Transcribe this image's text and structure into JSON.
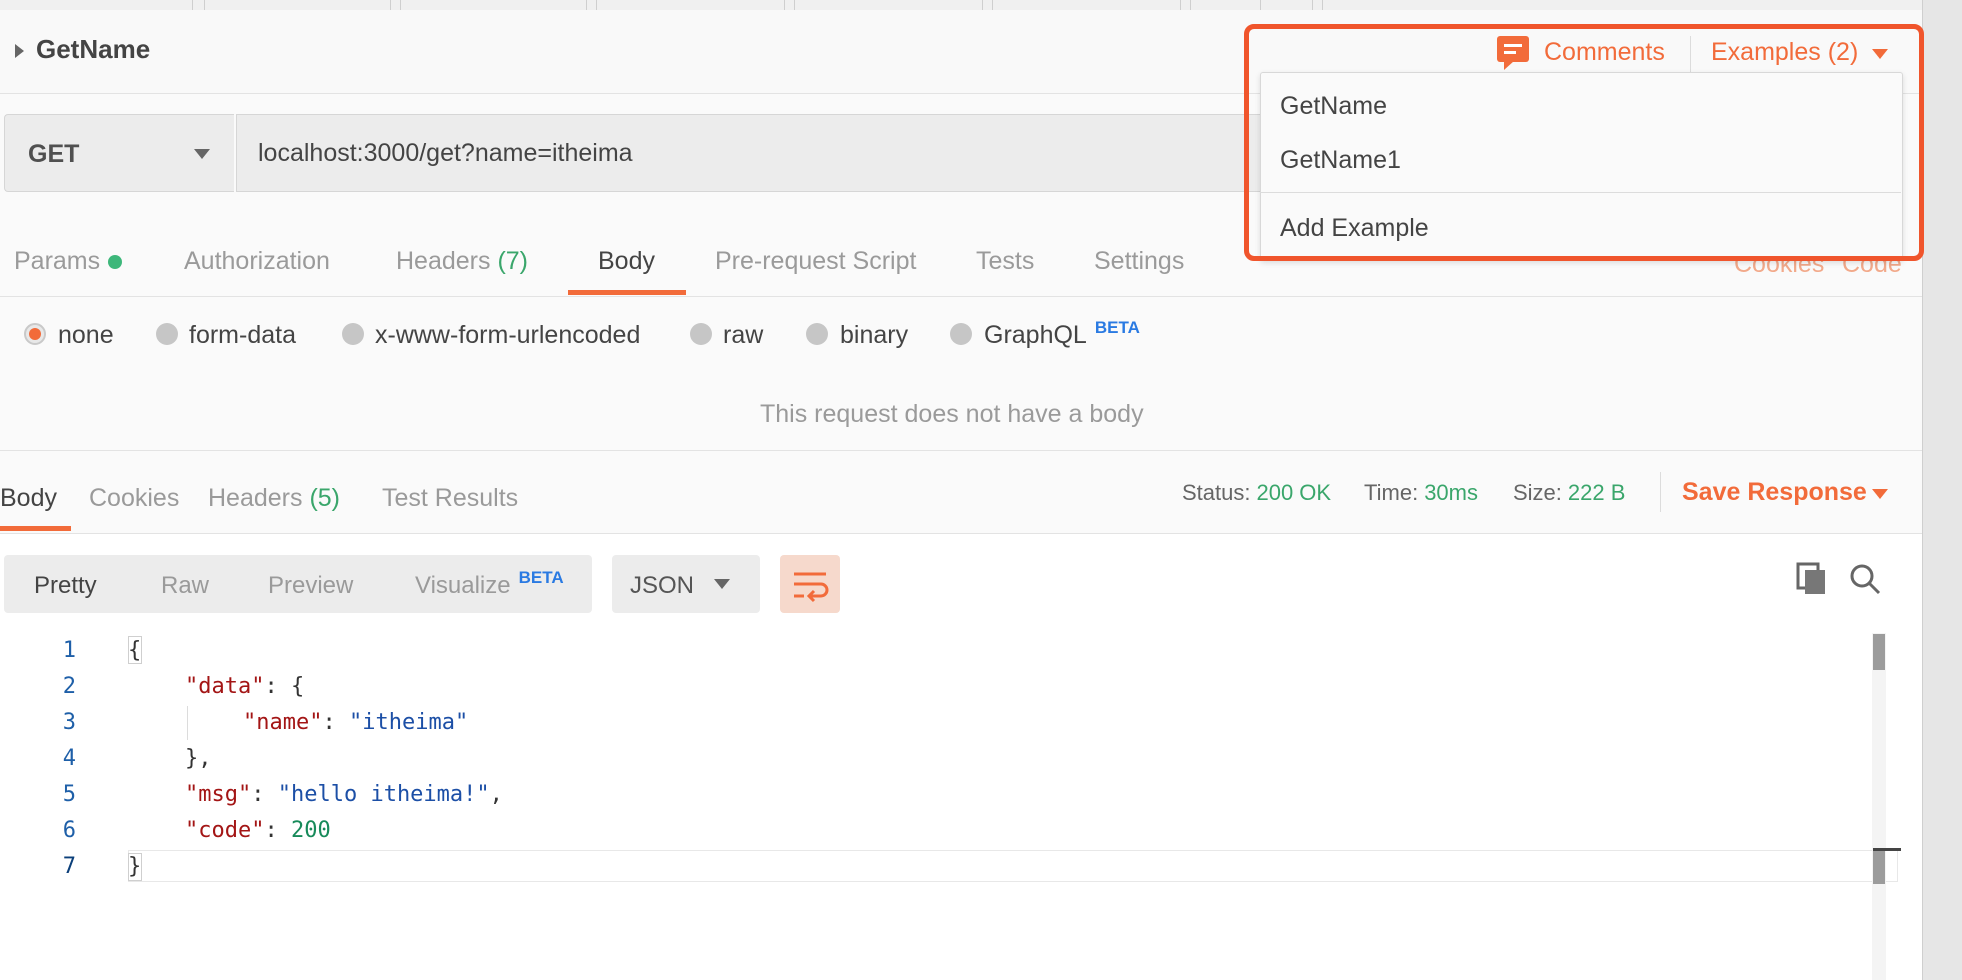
{
  "request": {
    "name": "GetName",
    "method": "GET",
    "url": "localhost:3000/get?name=itheima"
  },
  "header_actions": {
    "comments_label": "Comments",
    "examples_label": "Examples (2)"
  },
  "examples_menu": {
    "items": [
      "GetName",
      "GetName1"
    ],
    "add_label": "Add Example"
  },
  "request_tabs": {
    "params": "Params",
    "authorization": "Authorization",
    "headers": "Headers",
    "headers_count": "(7)",
    "body": "Body",
    "prerequest": "Pre-request Script",
    "tests": "Tests",
    "settings": "Settings",
    "cookies": "Cookies",
    "code": "Code"
  },
  "body_types": {
    "none": "none",
    "form_data": "form-data",
    "urlencoded": "x-www-form-urlencoded",
    "raw": "raw",
    "binary": "binary",
    "graphql": "GraphQL",
    "beta": "BETA",
    "selected": "none"
  },
  "no_body_message": "This request does not have a body",
  "response": {
    "tabs": {
      "body": "Body",
      "cookies": "Cookies",
      "headers": "Headers",
      "headers_count": "(5)",
      "test_results": "Test Results"
    },
    "status_key": "Status:",
    "status_val": "200 OK",
    "time_key": "Time:",
    "time_val": "30ms",
    "size_key": "Size:",
    "size_val": "222 B",
    "save_label": "Save Response"
  },
  "view": {
    "pretty": "Pretty",
    "raw": "Raw",
    "preview": "Preview",
    "visualize": "Visualize",
    "beta": "BETA",
    "format": "JSON"
  },
  "code": {
    "line_numbers": [
      "1",
      "2",
      "3",
      "4",
      "5",
      "6",
      "7"
    ],
    "l1": "{",
    "l2_key": "\"data\"",
    "l2_rest": ": {",
    "l3_key": "\"name\"",
    "l3_sep": ": ",
    "l3_val": "\"itheima\"",
    "l4": "},",
    "l5_key": "\"msg\"",
    "l5_sep": ": ",
    "l5_val": "\"hello itheima!\"",
    "l5_end": ",",
    "l6_key": "\"code\"",
    "l6_sep": ": ",
    "l6_val": "200",
    "l7": "}"
  },
  "colors": {
    "accent": "#f26b3a",
    "highlight_border": "#f0552c",
    "success": "#3aa66b",
    "beta": "#2a7ae2"
  },
  "icons": [
    "caret-right-icon",
    "chevron-down-icon",
    "comment-icon",
    "copy-icon",
    "search-icon",
    "wrap-lines-icon"
  ]
}
